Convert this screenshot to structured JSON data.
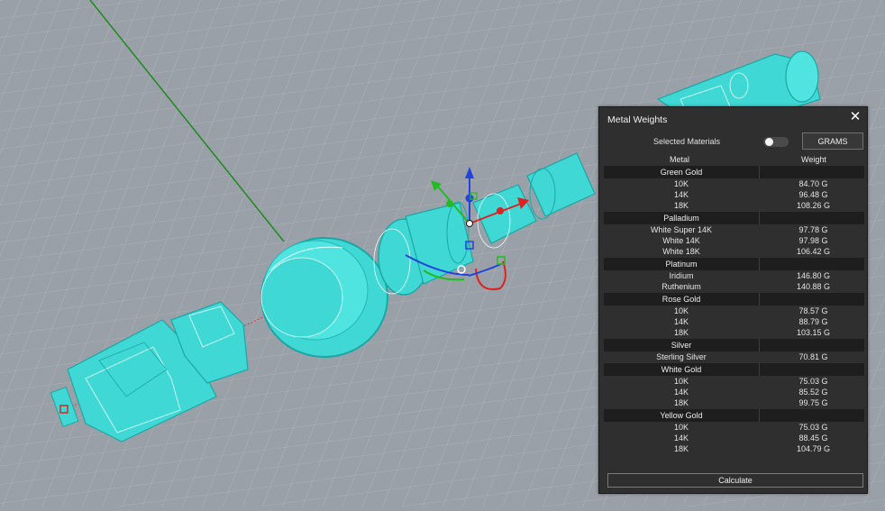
{
  "panel": {
    "title": "Metal Weights",
    "close_icon": "close-icon",
    "selected_materials_label": "Selected Materials",
    "unit_button": "GRAMS",
    "column_metal": "Metal",
    "column_weight": "Weight",
    "calculate_label": "Calculate",
    "groups": [
      {
        "name": "Green Gold",
        "items": [
          {
            "name": "10K",
            "weight": "84.70 G"
          },
          {
            "name": "14K",
            "weight": "96.48 G"
          },
          {
            "name": "18K",
            "weight": "108.26 G"
          }
        ]
      },
      {
        "name": "Palladium",
        "items": [
          {
            "name": "White Super 14K",
            "weight": "97.78 G"
          },
          {
            "name": "White 14K",
            "weight": "97.98 G"
          },
          {
            "name": "White 18K",
            "weight": "106.42 G"
          }
        ]
      },
      {
        "name": "Platinum",
        "items": [
          {
            "name": "Iridium",
            "weight": "146.80 G"
          },
          {
            "name": "Ruthenium",
            "weight": "140.88 G"
          }
        ]
      },
      {
        "name": "Rose Gold",
        "items": [
          {
            "name": "10K",
            "weight": "78.57 G"
          },
          {
            "name": "14K",
            "weight": "88.79 G"
          },
          {
            "name": "18K",
            "weight": "103.15 G"
          }
        ]
      },
      {
        "name": "Silver",
        "items": [
          {
            "name": "Sterling Silver",
            "weight": "70.81 G"
          }
        ]
      },
      {
        "name": "White Gold",
        "items": [
          {
            "name": "10K",
            "weight": "75.03 G"
          },
          {
            "name": "14K",
            "weight": "85.52 G"
          },
          {
            "name": "18K",
            "weight": "99.75 G"
          }
        ]
      },
      {
        "name": "Yellow Gold",
        "items": [
          {
            "name": "10K",
            "weight": "75.03 G"
          },
          {
            "name": "14K",
            "weight": "88.45 G"
          },
          {
            "name": "18K",
            "weight": "104.79 G"
          }
        ]
      }
    ]
  },
  "viewport": {
    "background_color": "#9aa0a7",
    "model_color": "#3fd8d4",
    "gizmo_icons": [
      "move-arrow-x-icon",
      "move-arrow-y-icon",
      "move-arrow-z-icon"
    ]
  }
}
